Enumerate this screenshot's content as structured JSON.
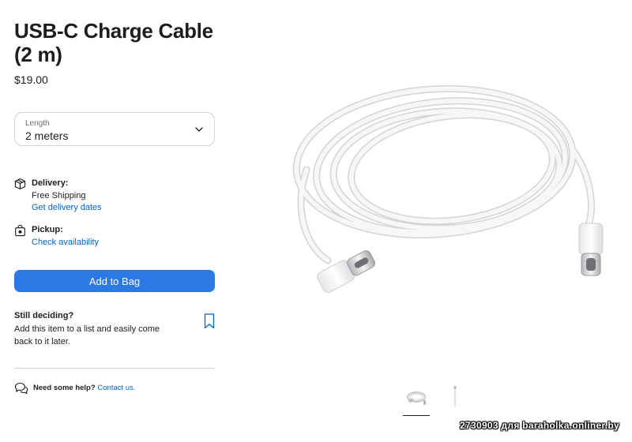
{
  "product": {
    "title": "USB-C Charge Cable (2 m)",
    "price": "$19.00"
  },
  "length_select": {
    "label": "Length",
    "value": "2 meters",
    "icon": "chevron-down-icon"
  },
  "delivery": {
    "heading": "Delivery:",
    "detail": "Free Shipping",
    "link": "Get delivery dates",
    "icon": "box-icon"
  },
  "pickup": {
    "heading": "Pickup:",
    "link": "Check availability",
    "icon": "bag-icon"
  },
  "add_to_bag": {
    "label": "Add to Bag",
    "color": "#2c79e3"
  },
  "deciding": {
    "heading": "Still deciding?",
    "text": "Add this item to a list and easily come back to it later.",
    "icon": "bookmark-icon"
  },
  "help": {
    "question": "Need some help?",
    "link": "Contact us.",
    "icon": "chat-bubbles-icon"
  },
  "gallery": {
    "selected_index": 0,
    "count": 2
  },
  "watermark": "2730903 для baraholka.onliner.by",
  "colors": {
    "link": "#0066cc",
    "text": "#1d1d1f",
    "border": "#d2d2d7"
  }
}
